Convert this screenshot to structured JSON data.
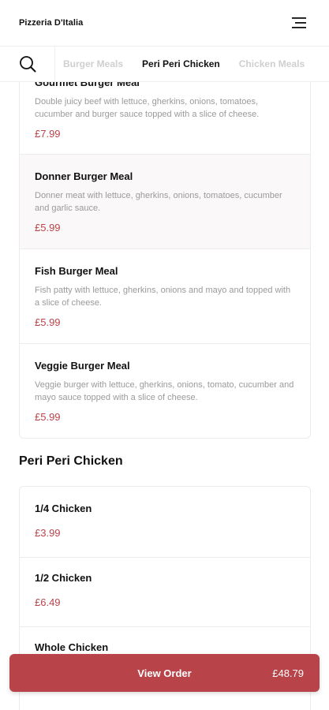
{
  "header": {
    "brand": "Pizzeria D'Italia",
    "menu_icon": "hamburger-menu-icon"
  },
  "category_nav": {
    "search_icon": "search-icon",
    "tabs": [
      {
        "label": "Burger Meals",
        "active": false
      },
      {
        "label": "Peri Peri Chicken",
        "active": true
      },
      {
        "label": "Chicken Meals",
        "active": false
      }
    ]
  },
  "burger_meals": {
    "items": [
      {
        "name": "Gourmet Burger Meal",
        "description": "Double juicy beef with lettuce, gherkins, onions, tomatoes, cucumber and burger sauce topped with a slice of cheese.",
        "price": "£7.99"
      },
      {
        "name": "Donner Burger Meal",
        "description": "Donner meat with lettuce, gherkins, onions, tomatoes, cucumber and garlic sauce.",
        "price": "£5.99"
      },
      {
        "name": "Fish Burger Meal",
        "description": "Fish patty with lettuce, gherkins, onions and mayo and topped with a slice of cheese.",
        "price": "£5.99"
      },
      {
        "name": "Veggie Burger Meal",
        "description": "Veggie burger with lettuce, gherkins, onions, tomato, cucumber and mayo sauce topped with a slice of cheese.",
        "price": "£5.99"
      }
    ]
  },
  "peri_peri_chicken": {
    "heading": "Peri Peri Chicken",
    "items": [
      {
        "name": "1/4 Chicken",
        "price": "£3.99"
      },
      {
        "name": "1/2 Chicken",
        "price": "£6.49"
      },
      {
        "name": "Whole Chicken",
        "price": ""
      }
    ]
  },
  "order_bar": {
    "label": "View Order",
    "total": "£48.79"
  },
  "colors": {
    "accent": "#b8444a",
    "muted_text": "#9a9a9a",
    "inactive_tab": "#cfcfcf"
  }
}
